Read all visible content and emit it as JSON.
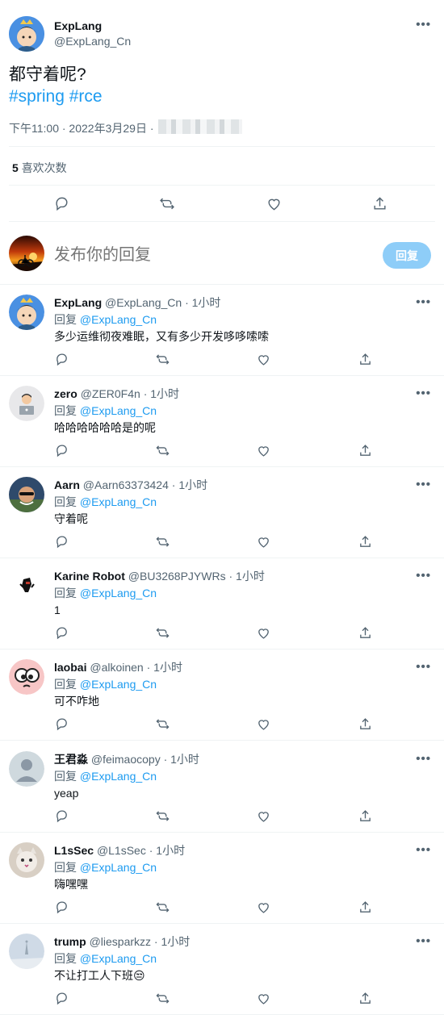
{
  "main_tweet": {
    "author_name": "ExpLang",
    "author_handle": "@ExpLang_Cn",
    "text": "都守着呢?",
    "hashtags": [
      "#spring",
      "#rce"
    ],
    "timestamp": "下午11:00 · 2022年3月29日 ·",
    "likes_count": "5",
    "likes_label": "喜欢次数"
  },
  "composer": {
    "placeholder": "发布你的回复",
    "button_label": "回复"
  },
  "reply_prefix": "回复",
  "replies": [
    {
      "name": "ExpLang",
      "handle": "@ExpLang_Cn",
      "time": "· 1小时",
      "to": "@ExpLang_Cn",
      "text": "多少运维彻夜难眠，又有多少开发哆哆嗦嗦",
      "avatar": "explang"
    },
    {
      "name": "zero",
      "handle": "@ZER0F4n",
      "time": "· 1小时",
      "to": "@ExpLang_Cn",
      "text": "哈哈哈哈哈哈是的呢",
      "avatar": "zero"
    },
    {
      "name": "Aarn",
      "handle": "@Aarn63373424",
      "time": "· 1小时",
      "to": "@ExpLang_Cn",
      "text": "守着呢",
      "avatar": "aarn"
    },
    {
      "name": "Karine Robot",
      "handle": "@BU3268PJYWRs",
      "time": "· 1小时",
      "to": "@ExpLang_Cn",
      "text": "1",
      "avatar": "karine"
    },
    {
      "name": "laobai",
      "handle": "@alkoinen",
      "time": "· 1小时",
      "to": "@ExpLang_Cn",
      "text": "可不咋地",
      "avatar": "laobai"
    },
    {
      "name": "王君淼",
      "handle": "@feimaocopy",
      "time": "· 1小时",
      "to": "@ExpLang_Cn",
      "text": "yeap",
      "avatar": "default"
    },
    {
      "name": "L1sSec",
      "handle": "@L1sSec",
      "time": "· 1小时",
      "to": "@ExpLang_Cn",
      "text": "嗨嘿嘿",
      "avatar": "cat"
    },
    {
      "name": "trump",
      "handle": "@liesparkzz",
      "time": "· 1小时",
      "to": "@ExpLang_Cn",
      "text": "不让打工人下班😒",
      "avatar": "trump"
    }
  ]
}
